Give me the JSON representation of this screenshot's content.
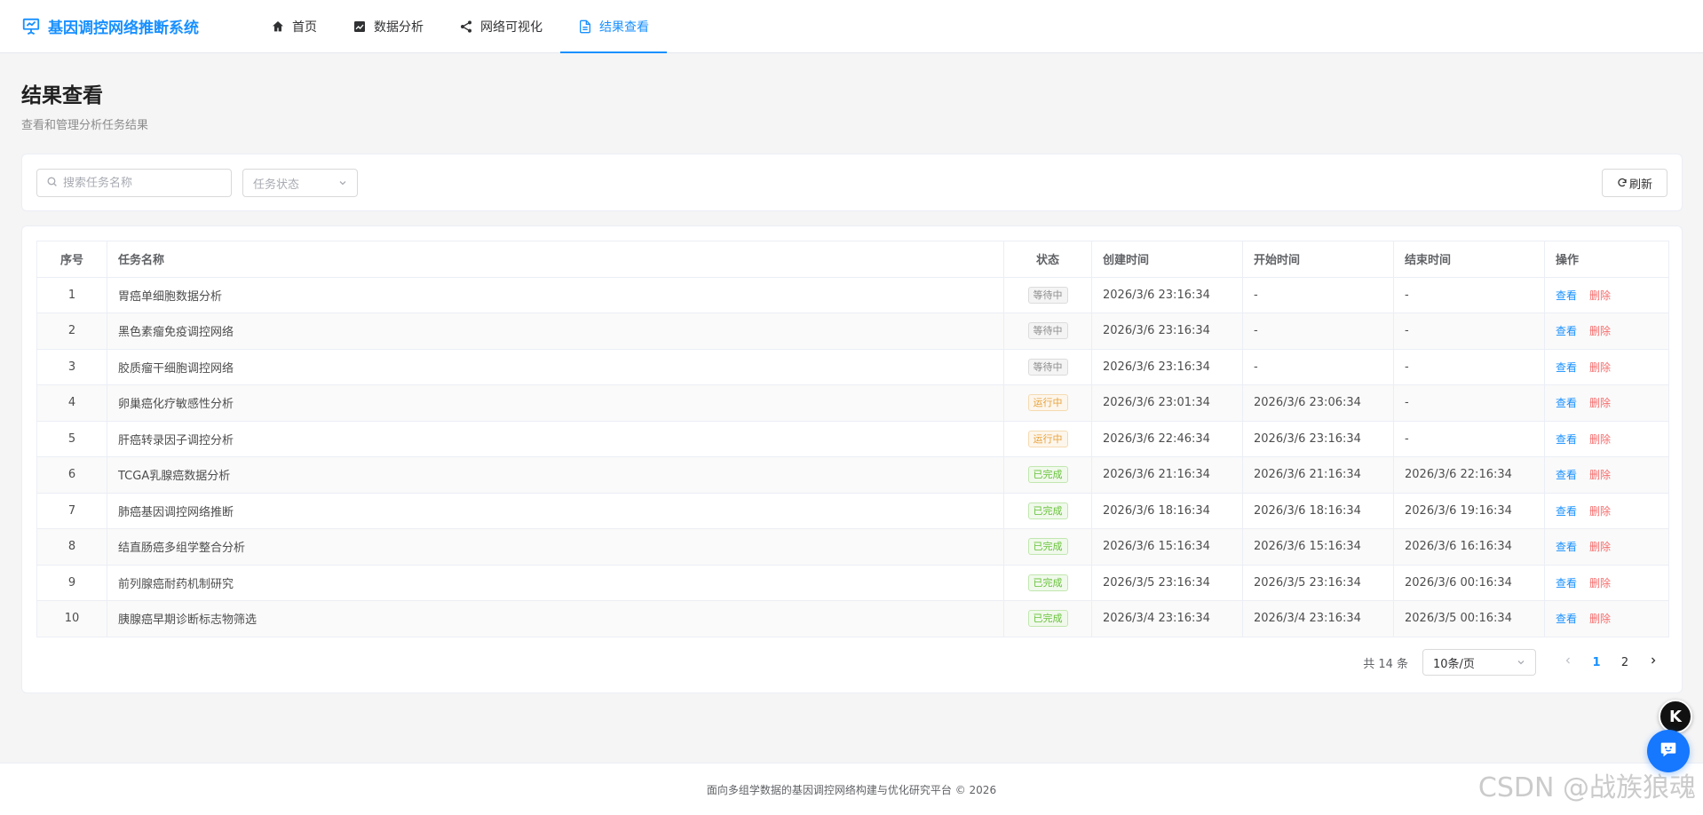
{
  "app": {
    "title": "基因调控网络推断系统"
  },
  "nav": [
    {
      "label": "首页",
      "icon": "home-icon"
    },
    {
      "label": "数据分析",
      "icon": "chart-icon"
    },
    {
      "label": "网络可视化",
      "icon": "share-icon"
    },
    {
      "label": "结果查看",
      "icon": "document-icon",
      "active": true
    }
  ],
  "page": {
    "title": "结果查看",
    "subtitle": "查看和管理分析任务结果"
  },
  "filters": {
    "search_placeholder": "搜索任务名称",
    "status_placeholder": "任务状态",
    "refresh_label": "刷新"
  },
  "table": {
    "columns": [
      "序号",
      "任务名称",
      "状态",
      "创建时间",
      "开始时间",
      "结束时间",
      "操作"
    ],
    "view_label": "查看",
    "delete_label": "删除",
    "rows": [
      {
        "no": "1",
        "name": "胃癌单细胞数据分析",
        "status": "等待中",
        "status_type": "waiting",
        "created": "2026/3/6 23:16:34",
        "started": "-",
        "ended": "-"
      },
      {
        "no": "2",
        "name": "黑色素瘤免疫调控网络",
        "status": "等待中",
        "status_type": "waiting",
        "created": "2026/3/6 23:16:34",
        "started": "-",
        "ended": "-"
      },
      {
        "no": "3",
        "name": "胶质瘤干细胞调控网络",
        "status": "等待中",
        "status_type": "waiting",
        "created": "2026/3/6 23:16:34",
        "started": "-",
        "ended": "-"
      },
      {
        "no": "4",
        "name": "卵巢癌化疗敏感性分析",
        "status": "运行中",
        "status_type": "running",
        "created": "2026/3/6 23:01:34",
        "started": "2026/3/6 23:06:34",
        "ended": "-"
      },
      {
        "no": "5",
        "name": "肝癌转录因子调控分析",
        "status": "运行中",
        "status_type": "running",
        "created": "2026/3/6 22:46:34",
        "started": "2026/3/6 23:16:34",
        "ended": "-"
      },
      {
        "no": "6",
        "name": "TCGA乳腺癌数据分析",
        "status": "已完成",
        "status_type": "done",
        "created": "2026/3/6 21:16:34",
        "started": "2026/3/6 21:16:34",
        "ended": "2026/3/6 22:16:34"
      },
      {
        "no": "7",
        "name": "肺癌基因调控网络推断",
        "status": "已完成",
        "status_type": "done",
        "created": "2026/3/6 18:16:34",
        "started": "2026/3/6 18:16:34",
        "ended": "2026/3/6 19:16:34"
      },
      {
        "no": "8",
        "name": "结直肠癌多组学整合分析",
        "status": "已完成",
        "status_type": "done",
        "created": "2026/3/6 15:16:34",
        "started": "2026/3/6 15:16:34",
        "ended": "2026/3/6 16:16:34"
      },
      {
        "no": "9",
        "name": "前列腺癌耐药机制研究",
        "status": "已完成",
        "status_type": "done",
        "created": "2026/3/5 23:16:34",
        "started": "2026/3/5 23:16:34",
        "ended": "2026/3/6 00:16:34"
      },
      {
        "no": "10",
        "name": "胰腺癌早期诊断标志物筛选",
        "status": "已完成",
        "status_type": "done",
        "created": "2026/3/4 23:16:34",
        "started": "2026/3/4 23:16:34",
        "ended": "2026/3/5 00:16:34"
      }
    ]
  },
  "pagination": {
    "total_label": "共 14 条",
    "page_size": "10条/页",
    "pages": [
      "1",
      "2"
    ],
    "current": "1"
  },
  "footer": {
    "text": "面向多组学数据的基因调控网络构建与优化研究平台 © 2026"
  },
  "float": {
    "k_label": "K"
  },
  "watermark": "CSDN @战族狼魂",
  "colors": {
    "accent": "#1890ff",
    "danger": "#f56c6c",
    "warning": "#e6a23c",
    "success": "#67c23a"
  }
}
